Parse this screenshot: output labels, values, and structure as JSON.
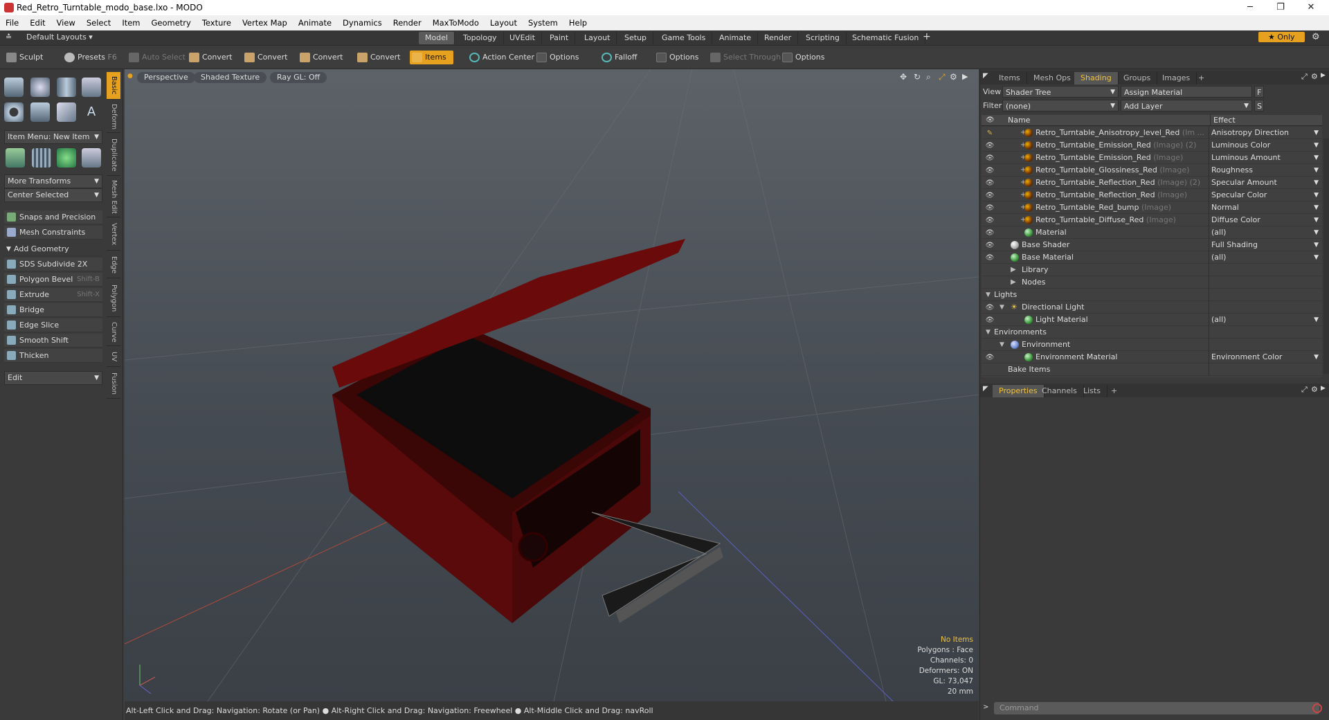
{
  "window": {
    "title": "Red_Retro_Turntable_modo_base.lxo - MODO",
    "minimize": "─",
    "maximize": "❐",
    "close": "✕"
  },
  "menu": [
    "File",
    "Edit",
    "View",
    "Select",
    "Item",
    "Geometry",
    "Texture",
    "Vertex Map",
    "Animate",
    "Dynamics",
    "Render",
    "MaxToModo",
    "Layout",
    "System",
    "Help"
  ],
  "layoutbar": {
    "layouts": "Default Layouts ▾",
    "tabs": [
      "Model",
      "Topology",
      "UVEdit",
      "Paint",
      "Layout",
      "Setup",
      "Game Tools",
      "Animate",
      "Render",
      "Scripting",
      "Schematic Fusion"
    ],
    "active_tab": "Model",
    "add": "+",
    "only": "★  Only",
    "gear": "⚙"
  },
  "toolbar": {
    "sculpt": "Sculpt",
    "presets": "Presets",
    "presets_key": "F6",
    "auto_select": "Auto Select",
    "convert": "Convert",
    "items": "Items",
    "action_center": "Action Center",
    "options": "Options",
    "falloff": "Falloff",
    "select_through": "Select Through"
  },
  "left": {
    "item_menu": "Item Menu: New Item",
    "more_transforms": "More Transforms",
    "center_selected": "Center Selected",
    "snaps": "Snaps and Precision",
    "mesh_constraints": "Mesh Constraints",
    "add_geometry": "Add Geometry",
    "edit": "Edit",
    "tools": [
      {
        "label": "SDS Subdivide 2X",
        "key": ""
      },
      {
        "label": "Polygon Bevel",
        "key": "Shift-B"
      },
      {
        "label": "Extrude",
        "key": "Shift-X"
      },
      {
        "label": "Bridge",
        "key": ""
      },
      {
        "label": "Edge Slice",
        "key": ""
      },
      {
        "label": "Smooth Shift",
        "key": ""
      },
      {
        "label": "Thicken",
        "key": ""
      }
    ],
    "vtabs": [
      "Basic",
      "Deform",
      "Duplicate",
      "Mesh Edit",
      "Vertex",
      "Edge",
      "Polygon",
      "Curve",
      "UV",
      "Fusion"
    ]
  },
  "viewport": {
    "perspective": "Perspective",
    "shading": "Shaded Texture",
    "raygl": "Ray GL: Off",
    "info": {
      "items": "No Items",
      "polygons": "Polygons : Face",
      "channels": "Channels: 0",
      "deformers": "Deformers: ON",
      "gl": "GL: 73,047",
      "size": "20 mm"
    }
  },
  "status": "Alt-Left Click and Drag: Navigation: Rotate (or Pan) ● Alt-Right Click and Drag: Navigation: Freewheel ● Alt-Middle Click and Drag: navRoll",
  "right": {
    "tabs": [
      "Items",
      "Mesh Ops",
      "Shading",
      "Groups",
      "Images"
    ],
    "active": "Shading",
    "add": "+",
    "view_label": "View",
    "view_value": "Shader Tree",
    "assign": "Assign Material",
    "f": "F",
    "filter_label": "Filter",
    "filter_value": "(none)",
    "add_layer": "Add Layer",
    "s": "S",
    "col_name": "Name",
    "col_effect": "Effect",
    "rows": [
      {
        "name": "Retro_Turntable_Anisotropy_level_Red",
        "sub": "(Im ...",
        "effect": "Anisotropy Direction",
        "type": "tex",
        "indent": 62,
        "plus": true,
        "eye": "brush"
      },
      {
        "name": "Retro_Turntable_Emission_Red",
        "sub": "(Image) (2)",
        "effect": "Luminous Color",
        "type": "tex",
        "indent": 62,
        "plus": true,
        "eye": "eye"
      },
      {
        "name": "Retro_Turntable_Emission_Red",
        "sub": "(Image)",
        "effect": "Luminous Amount",
        "type": "tex",
        "indent": 62,
        "plus": true,
        "eye": "eye"
      },
      {
        "name": "Retro_Turntable_Glossiness_Red",
        "sub": "(Image)",
        "effect": "Roughness",
        "type": "tex",
        "indent": 62,
        "plus": true,
        "eye": "eye"
      },
      {
        "name": "Retro_Turntable_Reflection_Red",
        "sub": "(Image) (2)",
        "effect": "Specular Amount",
        "type": "tex",
        "indent": 62,
        "plus": true,
        "eye": "eye"
      },
      {
        "name": "Retro_Turntable_Reflection_Red",
        "sub": "(Image)",
        "effect": "Specular Color",
        "type": "tex",
        "indent": 62,
        "plus": true,
        "eye": "eye"
      },
      {
        "name": "Retro_Turntable_Red_bump",
        "sub": "(Image)",
        "effect": "Normal",
        "type": "tex",
        "indent": 62,
        "plus": true,
        "eye": "eye"
      },
      {
        "name": "Retro_Turntable_Diffuse_Red",
        "sub": "(Image)",
        "effect": "Diffuse Color",
        "type": "tex",
        "indent": 62,
        "plus": true,
        "eye": "eye"
      },
      {
        "name": "Material",
        "sub": "",
        "effect": "(all)",
        "type": "mat",
        "indent": 62,
        "plus": false,
        "eye": "eye"
      },
      {
        "name": "Base Shader",
        "sub": "",
        "effect": "Full Shading",
        "type": "shd",
        "indent": 42,
        "plus": false,
        "eye": "eye"
      },
      {
        "name": "Base Material",
        "sub": "",
        "effect": "(all)",
        "type": "mat",
        "indent": 42,
        "plus": false,
        "eye": "eye"
      },
      {
        "name": "Library",
        "sub": "",
        "effect": "",
        "type": "folder",
        "indent": 42,
        "plus": false,
        "eye": ""
      },
      {
        "name": "Nodes",
        "sub": "",
        "effect": "",
        "type": "folder",
        "indent": 42,
        "plus": false,
        "eye": ""
      },
      {
        "name": "Lights",
        "sub": "",
        "effect": "",
        "type": "group",
        "indent": 22,
        "plus": false,
        "eye": ""
      },
      {
        "name": "Directional Light",
        "sub": "",
        "effect": "",
        "type": "light",
        "indent": 42,
        "plus": false,
        "eye": "eye"
      },
      {
        "name": "Light Material",
        "sub": "",
        "effect": "(all)",
        "type": "mat",
        "indent": 62,
        "plus": false,
        "eye": "eye"
      },
      {
        "name": "Environments",
        "sub": "",
        "effect": "",
        "type": "group",
        "indent": 22,
        "plus": false,
        "eye": ""
      },
      {
        "name": "Environment",
        "sub": "",
        "effect": "",
        "type": "env",
        "indent": 42,
        "plus": false,
        "eye": ""
      },
      {
        "name": "Environment Material",
        "sub": "",
        "effect": "Environment Color",
        "type": "mat",
        "indent": 62,
        "plus": false,
        "eye": "eye"
      },
      {
        "name": "Bake Items",
        "sub": "",
        "effect": "",
        "type": "plain",
        "indent": 42,
        "plus": false,
        "eye": ""
      }
    ],
    "bottom_tabs": [
      "Properties",
      "Channels",
      "Lists"
    ],
    "bottom_active": "Properties",
    "command": "Command"
  }
}
